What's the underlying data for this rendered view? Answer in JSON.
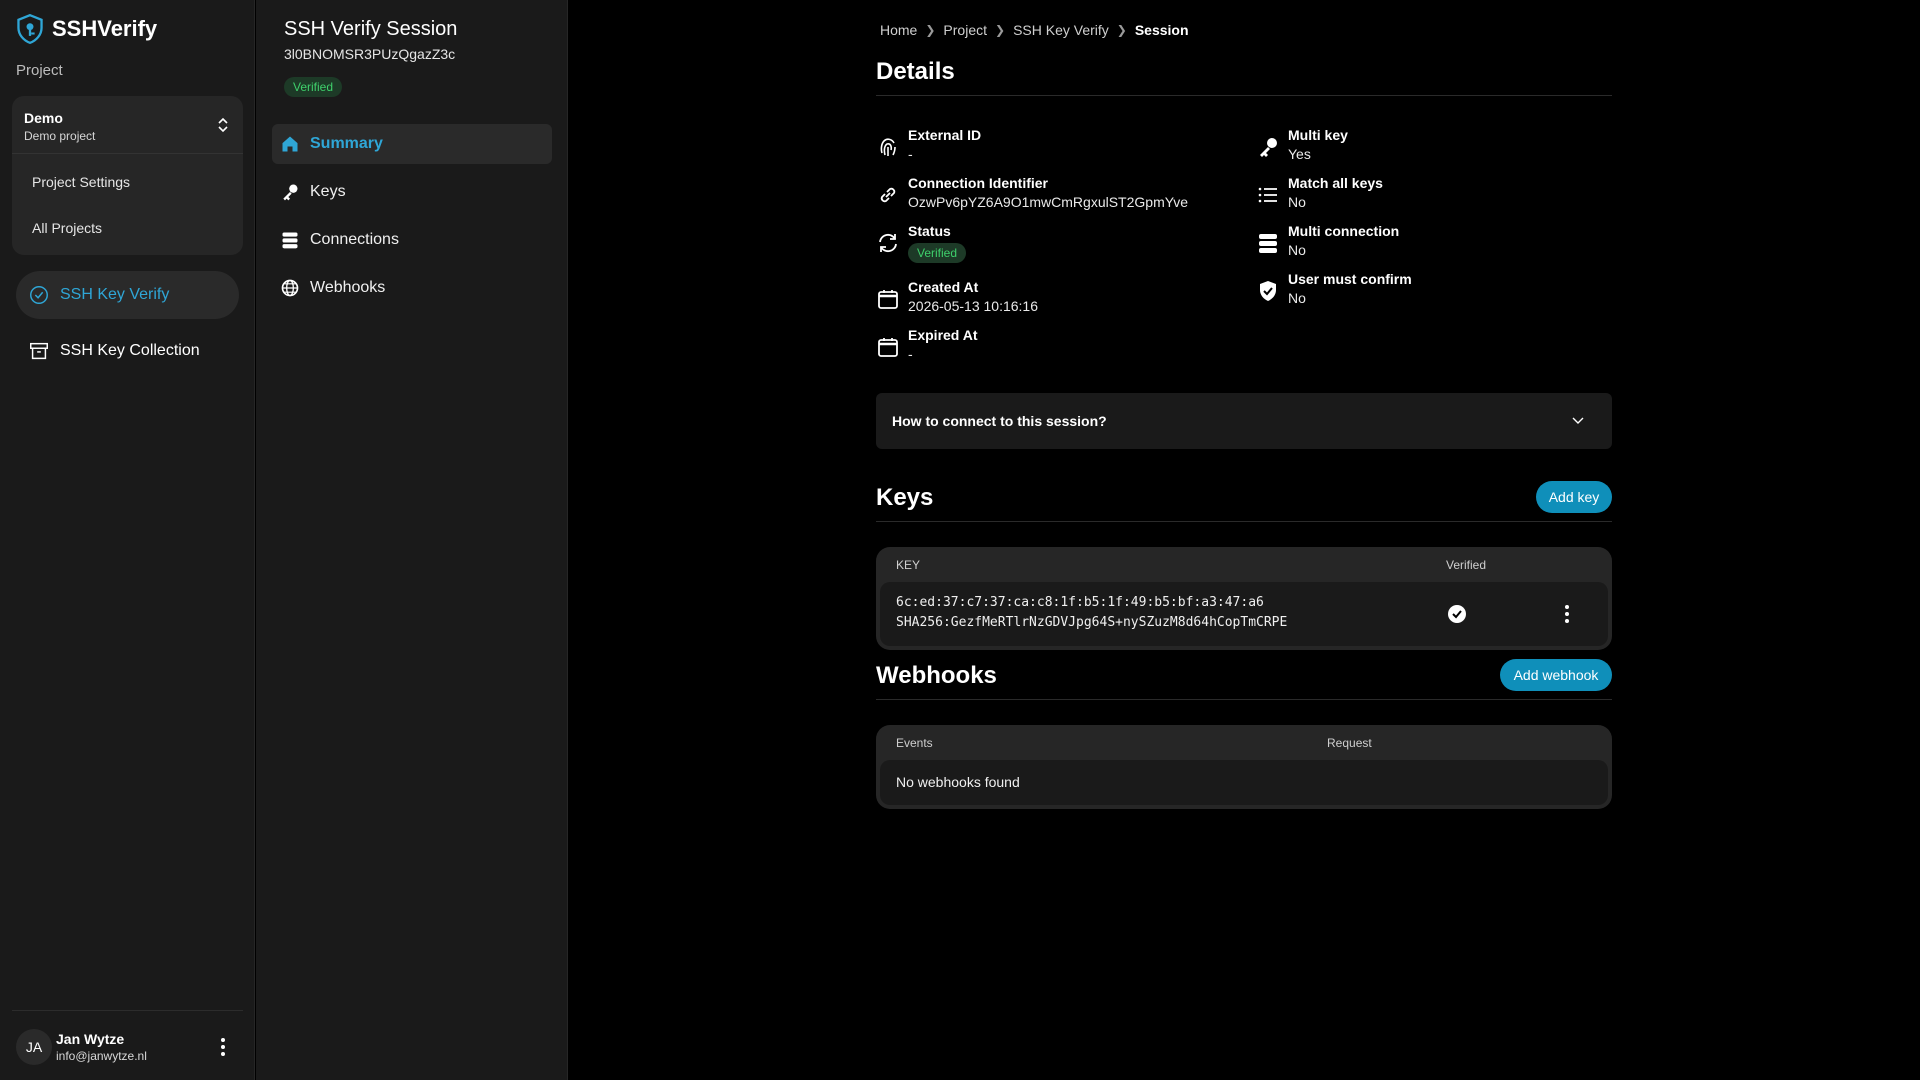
{
  "app": {
    "name": "SSHVerify"
  },
  "sidebar": {
    "project_label": "Project",
    "project": {
      "name": "Demo",
      "description": "Demo project"
    },
    "project_menu": [
      "Project Settings",
      "All Projects"
    ],
    "nav": [
      {
        "label": "SSH Key Verify",
        "icon": "check-circle-icon",
        "active": true
      },
      {
        "label": "SSH Key Collection",
        "icon": "archive-icon",
        "active": false
      }
    ],
    "user": {
      "initials": "JA",
      "name": "Jan Wytze",
      "email": "info@janwytze.nl"
    }
  },
  "session": {
    "title": "SSH Verify Session",
    "id": "3l0BNOMSR3PUzQgazZ3c",
    "badge": "Verified",
    "nav": [
      {
        "label": "Summary",
        "icon": "home-icon",
        "active": true
      },
      {
        "label": "Keys",
        "icon": "key-icon",
        "active": false
      },
      {
        "label": "Connections",
        "icon": "database-icon",
        "active": false
      },
      {
        "label": "Webhooks",
        "icon": "globe-icon",
        "active": false
      }
    ]
  },
  "breadcrumb": [
    "Home",
    "Project",
    "SSH Key Verify",
    "Session"
  ],
  "details": {
    "title": "Details",
    "left": [
      {
        "label": "External ID",
        "value": "-"
      },
      {
        "label": "Connection Identifier",
        "value": "OzwPv6pYZ6A9O1mwCmRgxulST2GpmYve"
      },
      {
        "label": "Status",
        "value": "Verified"
      },
      {
        "label": "Created At",
        "value": "2026-05-13 10:16:16"
      },
      {
        "label": "Expired At",
        "value": "-"
      }
    ],
    "right": [
      {
        "label": "Multi key",
        "value": "Yes"
      },
      {
        "label": "Match all keys",
        "value": "No"
      },
      {
        "label": "Multi connection",
        "value": "No"
      },
      {
        "label": "User must confirm",
        "value": "No"
      }
    ]
  },
  "accordion": {
    "label": "How to connect to this session?"
  },
  "keys": {
    "title": "Keys",
    "add_label": "Add key",
    "columns": [
      "KEY",
      "Verified"
    ],
    "rows": [
      {
        "md5": "6c:ed:37:c7:37:ca:c8:1f:b5:1f:49:b5:bf:a3:47:a6",
        "sha": "SHA256:GezfMeRTlrNzGDVJpg64S+nySZuzM8d64hCopTmCRPE",
        "verified": true
      }
    ]
  },
  "webhooks": {
    "title": "Webhooks",
    "add_label": "Add webhook",
    "columns": [
      "Events",
      "Request"
    ],
    "empty": "No webhooks found"
  },
  "colors": {
    "accent": "#2fa6d6",
    "button": "#0f8fba",
    "success": "#3ecf6b",
    "panel": "#1a1a1a"
  }
}
